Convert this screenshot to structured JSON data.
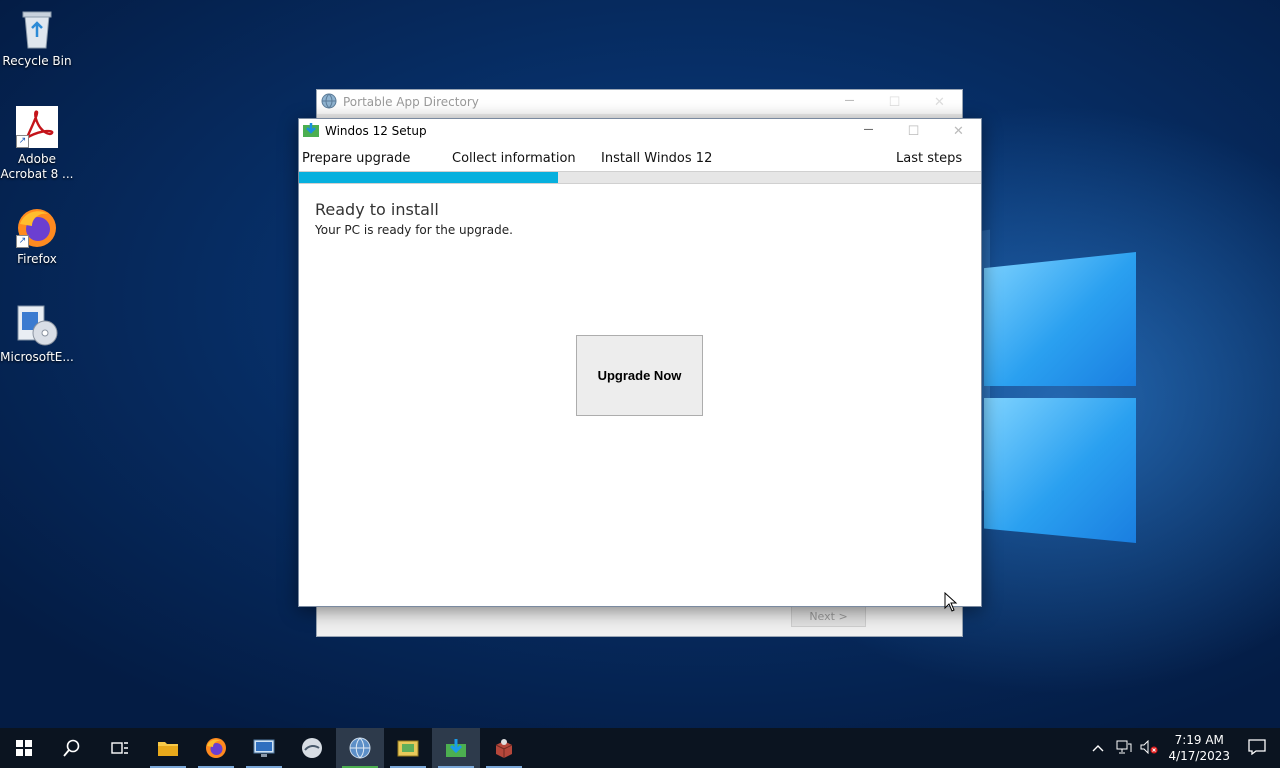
{
  "desktop": {
    "icons": [
      {
        "label": "Recycle Bin"
      },
      {
        "label": "Adobe\nAcrobat 8 ..."
      },
      {
        "label": "Firefox"
      },
      {
        "label": "MicrosoftE..."
      }
    ]
  },
  "background_window": {
    "title": "Portable App Directory",
    "next_label": "Next >"
  },
  "setup_window": {
    "title": "Windos 12 Setup",
    "steps": [
      "Prepare upgrade",
      "Collect information",
      "Install Windos 12",
      "Last steps"
    ],
    "progress_fraction": 0.38,
    "heading": "Ready to install",
    "subheading": "Your PC is ready for the upgrade.",
    "upgrade_button_label": "Upgrade Now"
  },
  "caption_buttons": {
    "minimize": "—",
    "maximize": "☐",
    "close": "✕"
  },
  "taskbar": {
    "time": "7:19 AM",
    "date": "4/17/2023"
  },
  "colors": {
    "progress": "#06b0de",
    "taskbar": "#0b1420"
  }
}
